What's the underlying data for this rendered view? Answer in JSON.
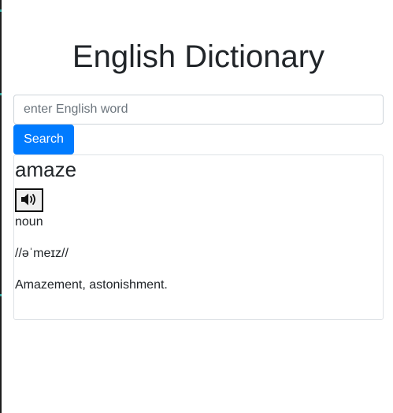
{
  "header": {
    "title": "English Dictionary"
  },
  "search": {
    "placeholder": "enter English word",
    "value": "",
    "button_label": "Search"
  },
  "result": {
    "word": "amaze",
    "audio_icon": "speaker-volume-icon",
    "part_of_speech": "noun",
    "phonetic": "//əˈmeɪz//",
    "definition": "Amazement, astonishment."
  },
  "colors": {
    "primary": "#007bff",
    "text": "#212529",
    "border": "#ced4da"
  }
}
